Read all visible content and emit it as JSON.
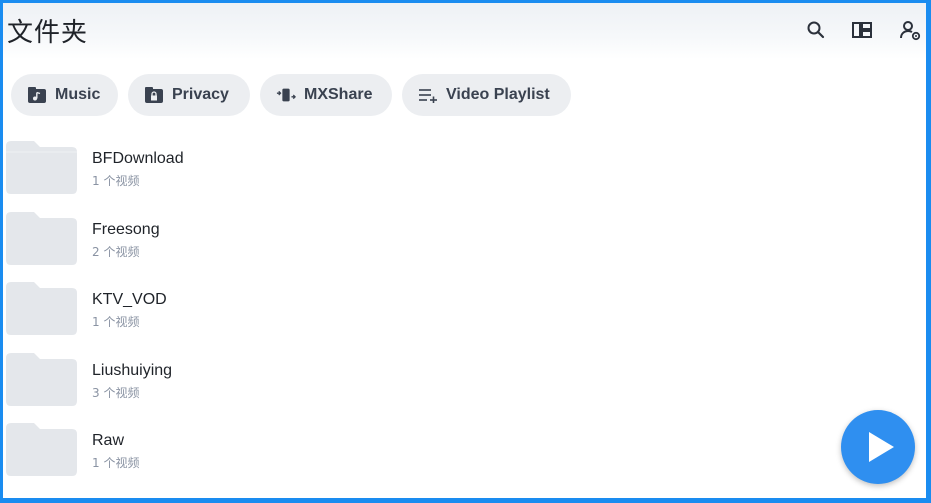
{
  "header": {
    "title": "文件夹",
    "icons": [
      "search-icon",
      "layout-icon",
      "account-settings-icon"
    ]
  },
  "chips": [
    {
      "label": "Music",
      "icon": "music-folder-icon"
    },
    {
      "label": "Privacy",
      "icon": "lock-folder-icon"
    },
    {
      "label": "MXShare",
      "icon": "share-transfer-icon"
    },
    {
      "label": "Video Playlist",
      "icon": "playlist-add-icon"
    }
  ],
  "folders": [
    {
      "name": "BFDownload",
      "count": "1 个视频"
    },
    {
      "name": "Freesong",
      "count": "2 个视频"
    },
    {
      "name": "KTV_VOD",
      "count": "1 个视频"
    },
    {
      "name": "Liushuiying",
      "count": "3 个视频"
    },
    {
      "name": "Raw",
      "count": "1 个视频"
    }
  ],
  "fab": {
    "icon": "play-icon"
  },
  "colors": {
    "accent": "#2f8ff0",
    "chip_bg": "#eceef1",
    "folder": "#e4e7eb"
  }
}
